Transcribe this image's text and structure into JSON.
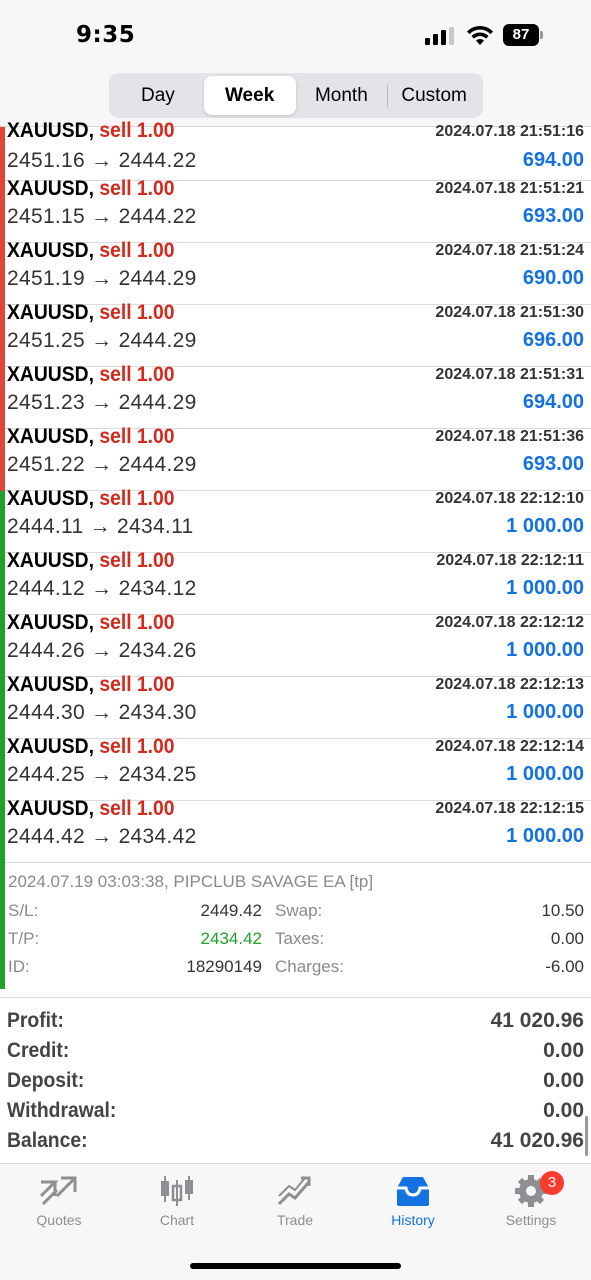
{
  "status": {
    "time": "9:35",
    "battery": "87"
  },
  "period_tabs": [
    {
      "label": "Day",
      "active": false
    },
    {
      "label": "Week",
      "active": true
    },
    {
      "label": "Month",
      "active": false
    },
    {
      "label": "Custom",
      "active": false
    }
  ],
  "deals": [
    {
      "symbol": "XAUUSD,",
      "side": "sell 1.00",
      "time": "2024.07.18 21:51:16",
      "prices": "2451.16 → 2444.22",
      "profit": "694.00",
      "bar_color": "#e0453a"
    },
    {
      "symbol": "XAUUSD,",
      "side": "sell 1.00",
      "time": "2024.07.18 21:51:21",
      "prices": "2451.15 → 2444.22",
      "profit": "693.00",
      "bar_color": "#e0453a"
    },
    {
      "symbol": "XAUUSD,",
      "side": "sell 1.00",
      "time": "2024.07.18 21:51:24",
      "prices": "2451.19 → 2444.29",
      "profit": "690.00",
      "bar_color": "#e0453a"
    },
    {
      "symbol": "XAUUSD,",
      "side": "sell 1.00",
      "time": "2024.07.18 21:51:30",
      "prices": "2451.25 → 2444.29",
      "profit": "696.00",
      "bar_color": "#e0453a"
    },
    {
      "symbol": "XAUUSD,",
      "side": "sell 1.00",
      "time": "2024.07.18 21:51:31",
      "prices": "2451.23 → 2444.29",
      "profit": "694.00",
      "bar_color": "#e0453a"
    },
    {
      "symbol": "XAUUSD,",
      "side": "sell 1.00",
      "time": "2024.07.18 21:51:36",
      "prices": "2451.22 → 2444.29",
      "profit": "693.00",
      "bar_color": "#e0453a"
    },
    {
      "symbol": "XAUUSD,",
      "side": "sell 1.00",
      "time": "2024.07.18 22:12:10",
      "prices": "2444.11 → 2434.11",
      "profit": "1 000.00",
      "bar_color": "#1fa22a"
    },
    {
      "symbol": "XAUUSD,",
      "side": "sell 1.00",
      "time": "2024.07.18 22:12:11",
      "prices": "2444.12 → 2434.12",
      "profit": "1 000.00",
      "bar_color": "#1fa22a"
    },
    {
      "symbol": "XAUUSD,",
      "side": "sell 1.00",
      "time": "2024.07.18 22:12:12",
      "prices": "2444.26 → 2434.26",
      "profit": "1 000.00",
      "bar_color": "#1fa22a"
    },
    {
      "symbol": "XAUUSD,",
      "side": "sell 1.00",
      "time": "2024.07.18 22:12:13",
      "prices": "2444.30 → 2434.30",
      "profit": "1 000.00",
      "bar_color": "#1fa22a"
    },
    {
      "symbol": "XAUUSD,",
      "side": "sell 1.00",
      "time": "2024.07.18 22:12:14",
      "prices": "2444.25 → 2434.25",
      "profit": "1 000.00",
      "bar_color": "#1fa22a"
    },
    {
      "symbol": "XAUUSD,",
      "side": "sell 1.00",
      "time": "2024.07.18 22:12:15",
      "prices": "2444.42 → 2434.42",
      "profit": "1 000.00",
      "bar_color": "#1fa22a"
    }
  ],
  "detail": {
    "comment": "2024.07.19 03:03:38, PIPCLUB SAVAGE EA [tp]",
    "sl_label": "S/L:",
    "sl_value": "2449.42",
    "tp_label": "T/P:",
    "tp_value": "2434.42",
    "id_label": "ID:",
    "id_value": "18290149",
    "swap_label": "Swap:",
    "swap_value": "10.50",
    "taxes_label": "Taxes:",
    "taxes_value": "0.00",
    "charges_label": "Charges:",
    "charges_value": "-6.00"
  },
  "summary": [
    {
      "label": "Profit:",
      "value": "41 020.96"
    },
    {
      "label": "Credit:",
      "value": "0.00"
    },
    {
      "label": "Deposit:",
      "value": "0.00"
    },
    {
      "label": "Withdrawal:",
      "value": "0.00"
    },
    {
      "label": "Balance:",
      "value": "41 020.96"
    }
  ],
  "tabbar": [
    {
      "label": "Quotes",
      "icon": "quotes-icon",
      "active": false
    },
    {
      "label": "Chart",
      "icon": "chart-icon",
      "active": false
    },
    {
      "label": "Trade",
      "icon": "trade-icon",
      "active": false
    },
    {
      "label": "History",
      "icon": "history-icon",
      "active": true
    },
    {
      "label": "Settings",
      "icon": "settings-icon",
      "active": false,
      "badge": "3"
    }
  ],
  "colors": {
    "accent": "#1471e0",
    "sell": "#d42a1e",
    "profit_green": "#1fa22a",
    "loss_red": "#e0453a"
  }
}
